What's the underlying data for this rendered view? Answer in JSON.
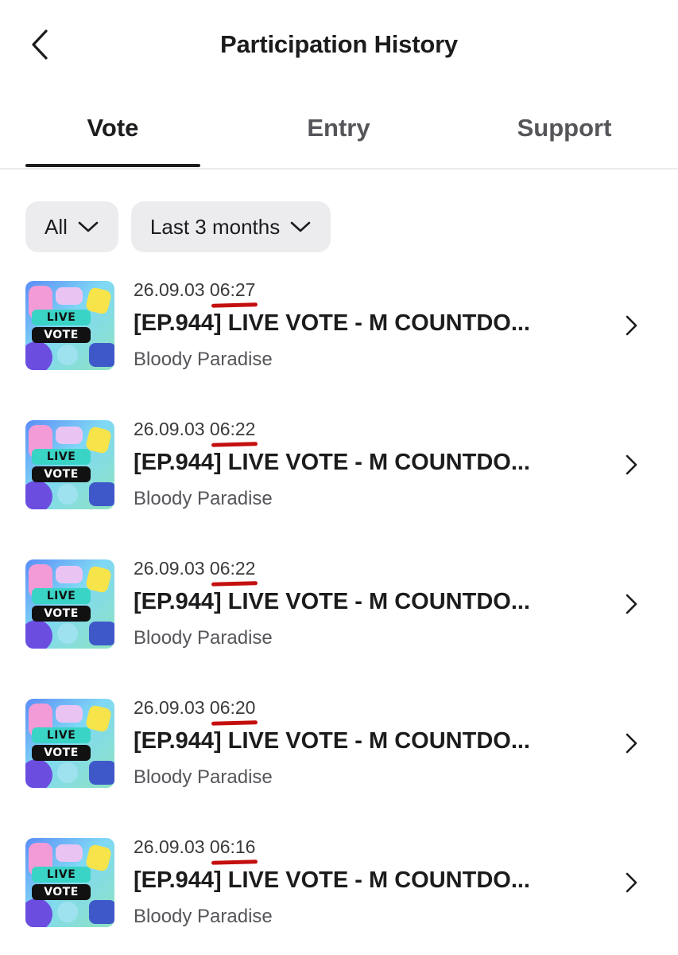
{
  "header": {
    "title": "Participation History",
    "back_icon": "chevron-left-icon"
  },
  "tabs": [
    {
      "label": "Vote",
      "active": true
    },
    {
      "label": "Entry",
      "active": false
    },
    {
      "label": "Support",
      "active": false
    }
  ],
  "filters": [
    {
      "label": "All",
      "icon": "chevron-down-icon"
    },
    {
      "label": "Last 3 months",
      "icon": "chevron-down-icon"
    }
  ],
  "items": [
    {
      "date": "26.09.03",
      "time": "06:27",
      "title": "[EP.944] LIVE VOTE - M COUNTDO...",
      "artist": "Bloody Paradise",
      "thumb_live": "LIVE",
      "thumb_vote": "VOTE"
    },
    {
      "date": "26.09.03",
      "time": "06:22",
      "title": "[EP.944] LIVE VOTE - M COUNTDO...",
      "artist": "Bloody Paradise",
      "thumb_live": "LIVE",
      "thumb_vote": "VOTE"
    },
    {
      "date": "26.09.03",
      "time": "06:22",
      "title": "[EP.944] LIVE VOTE - M COUNTDO...",
      "artist": "Bloody Paradise",
      "thumb_live": "LIVE",
      "thumb_vote": "VOTE"
    },
    {
      "date": "26.09.03",
      "time": "06:20",
      "title": "[EP.944] LIVE VOTE - M COUNTDO...",
      "artist": "Bloody Paradise",
      "thumb_live": "LIVE",
      "thumb_vote": "VOTE"
    },
    {
      "date": "26.09.03",
      "time": "06:16",
      "title": "[EP.944] LIVE VOTE - M COUNTDO...",
      "artist": "Bloody Paradise",
      "thumb_live": "LIVE",
      "thumb_vote": "VOTE"
    }
  ],
  "colors": {
    "text_primary": "#1c1c1e",
    "text_secondary": "#55555a",
    "chip_bg": "#ececef",
    "underline_annotation": "#c40f0f"
  }
}
